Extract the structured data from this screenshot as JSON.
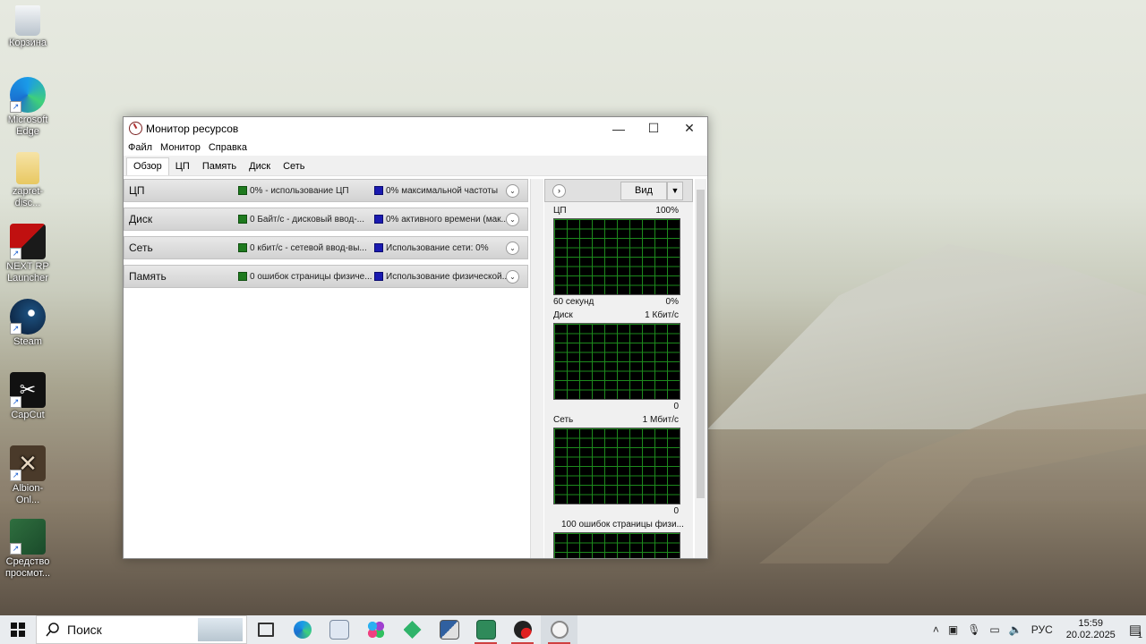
{
  "desktop": {
    "icons": [
      {
        "label": "Корзина"
      },
      {
        "label": "Microsoft Edge"
      },
      {
        "label": "zapret-disc..."
      },
      {
        "label": "NEXT RP Launcher"
      },
      {
        "label": "Steam"
      },
      {
        "label": "CapCut"
      },
      {
        "label": "Albion-Onl..."
      },
      {
        "label": "Средство просмот..."
      }
    ]
  },
  "window": {
    "title": "Монитор ресурсов",
    "menu": [
      "Файл",
      "Монитор",
      "Справка"
    ],
    "tabs": [
      "Обзор",
      "ЦП",
      "Память",
      "Диск",
      "Сеть"
    ],
    "active_tab": "Обзор",
    "sections": [
      {
        "name": "ЦП",
        "stat1": "0% - использование ЦП",
        "stat2": "0% максимальной частоты"
      },
      {
        "name": "Диск",
        "stat1": "0 Байт/с - дисковый ввод-...",
        "stat2": "0% активного времени (мак..."
      },
      {
        "name": "Сеть",
        "stat1": "0 кбит/с - сетевой ввод-вы...",
        "stat2": "Использование сети: 0%"
      },
      {
        "name": "Память",
        "stat1": "0 ошибок страницы физиче...",
        "stat2": "Использование физической..."
      }
    ],
    "right_panel": {
      "view_label": "Вид",
      "graphs": [
        {
          "title": "ЦП",
          "max": "100%",
          "bottom_left": "60 секунд",
          "bottom_right": "0%"
        },
        {
          "title": "Диск",
          "max": "1 Кбит/с",
          "bottom_left": "",
          "bottom_right": "0"
        },
        {
          "title": "Сеть",
          "max": "1 Мбит/с",
          "bottom_left": "",
          "bottom_right": "0"
        },
        {
          "title": "100 ошибок страницы физи...",
          "max": "",
          "bottom_left": "",
          "bottom_right": ""
        }
      ]
    }
  },
  "taskbar": {
    "search_label": "Поиск",
    "tray": {
      "lang": "РУС",
      "time": "15:59",
      "date": "20.02.2025",
      "notifications": "1"
    }
  },
  "colors": {
    "graph_bg": "#000000",
    "graph_grid": "#1d8a1d",
    "stat_green": "#1e7a1e",
    "stat_blue": "#1a1ab0"
  }
}
